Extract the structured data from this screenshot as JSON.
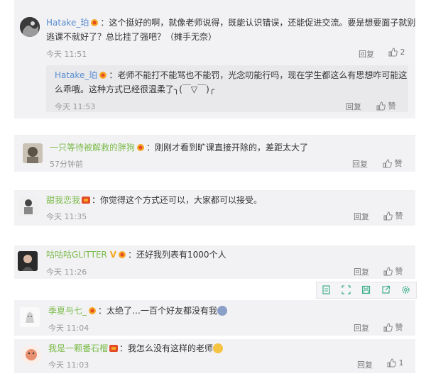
{
  "comments": [
    {
      "name": "Hatake_珀",
      "text_line1": "：这个挺好的啊，就像老师说得，既能认识错误，还能促进交流。要是想要面子就别",
      "text_line2": "逃课不就好了？总比挂了强吧？（摊手无奈）",
      "time": "今天 11:51",
      "reply": "回复",
      "likes": "2",
      "sub_reply": {
        "name": "Hatake_珀",
        "text_line1": "：老师不能打不能骂也不能罚，光念叨能行吗，现在学生都这么有思想咋可能这",
        "text_line2": "么乖哦。这种方式已经很温柔了╮(￣▽￣)╭",
        "time": "今天 11:53",
        "reply": "回复",
        "likes": "赞"
      }
    },
    {
      "name": "一只等待被解救的胖狗",
      "text": "：刚刚才看到旷课直接开除的，差距太大了",
      "time": "57分钟前",
      "reply": "回复",
      "likes": "赞"
    },
    {
      "name": "甜我恋我",
      "text": "：你觉得这个方式还可以，大家都可以接受。",
      "time": "今天 11:35",
      "reply": "回复",
      "likes": "赞"
    },
    {
      "name": "咕咕咕GLITTER",
      "vip": "V",
      "text": "：还好我列表有1000个人",
      "time": "今天 11:26",
      "reply": "回复",
      "likes": "赞"
    },
    {
      "name": "季夏与七_",
      "text": "：太绝了…一百个好友都没有我",
      "time": "今天 11:04",
      "reply": "回复",
      "likes": "赞"
    },
    {
      "name": "我是一颗番石榴",
      "text": "：我怎么没有这样的老师",
      "time": "今天 11:03",
      "reply": "回复",
      "likes": "1"
    }
  ],
  "colors": {
    "name_orange": "#eb7350",
    "name_green": "#7cbb4a",
    "name_blue": "#5a8ccf",
    "accent_green": "#3fae8c"
  },
  "toolbar_icons": [
    "copy-icon",
    "expand-icon",
    "save-icon",
    "share-icon",
    "settings-icon"
  ]
}
